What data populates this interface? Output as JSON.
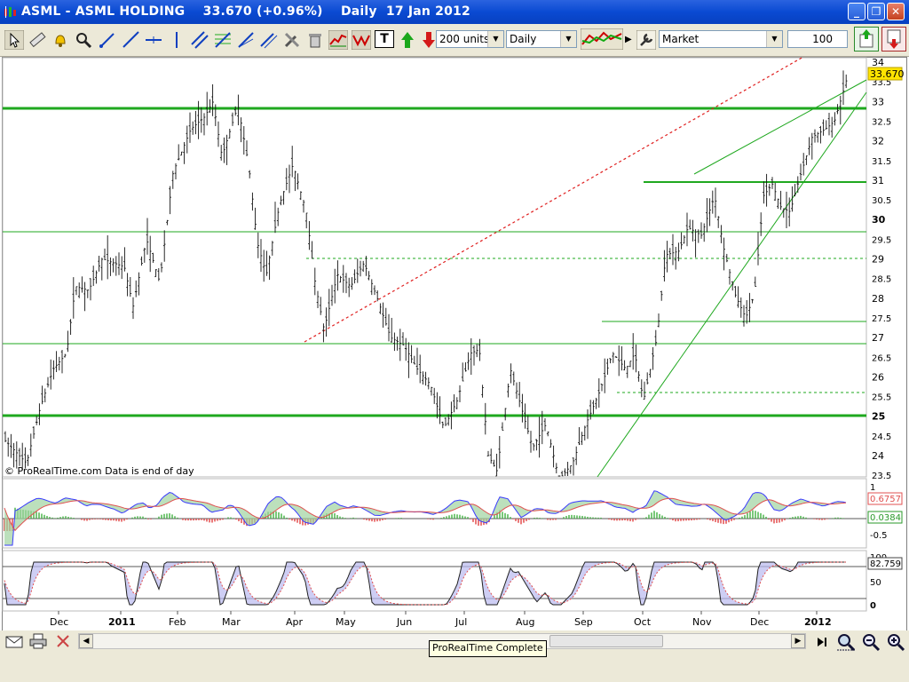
{
  "window": {
    "title": "ASML - ASML HOLDING    33.670 (+0.96%)    Daily  17 Jan 2012",
    "minimize": "_",
    "maximize": "❐",
    "close": "✕"
  },
  "toolbar": {
    "units": "200 units",
    "timeframe": "Daily",
    "order_type": "Market",
    "quantity": "100",
    "text_tool": "T"
  },
  "chart": {
    "price_label": "33.670",
    "watermark": "© ProRealTime.com  Data is end of day",
    "price_ticks": [
      "34",
      "33.5",
      "33",
      "32.5",
      "32",
      "31.5",
      "31",
      "30.5",
      "30",
      "29.5",
      "29",
      "28.5",
      "28",
      "27.5",
      "27",
      "26.5",
      "26",
      "25.5",
      "25",
      "24.5",
      "24",
      "23.5"
    ],
    "macd": {
      "ticks": [
        "1",
        "-0.5"
      ],
      "line_value": "0.6757",
      "hist_value": "0.0384"
    },
    "stoch": {
      "ticks": [
        "100",
        "50",
        "0"
      ],
      "value": "82.759"
    },
    "x_ticks": [
      "Dec",
      "2011",
      "Feb",
      "Mar",
      "Apr",
      "May",
      "Jun",
      "Jul",
      "Aug",
      "Sep",
      "Oct",
      "Nov",
      "Dec",
      "2012"
    ]
  },
  "status": {
    "tooltip": "ProRealTime Complete"
  },
  "colors": {
    "title_bar": "#0a4ad2",
    "support_lines": "#1fa81f",
    "trend_dotted": "#e02020",
    "price_label_bg": "#ffe400"
  }
}
